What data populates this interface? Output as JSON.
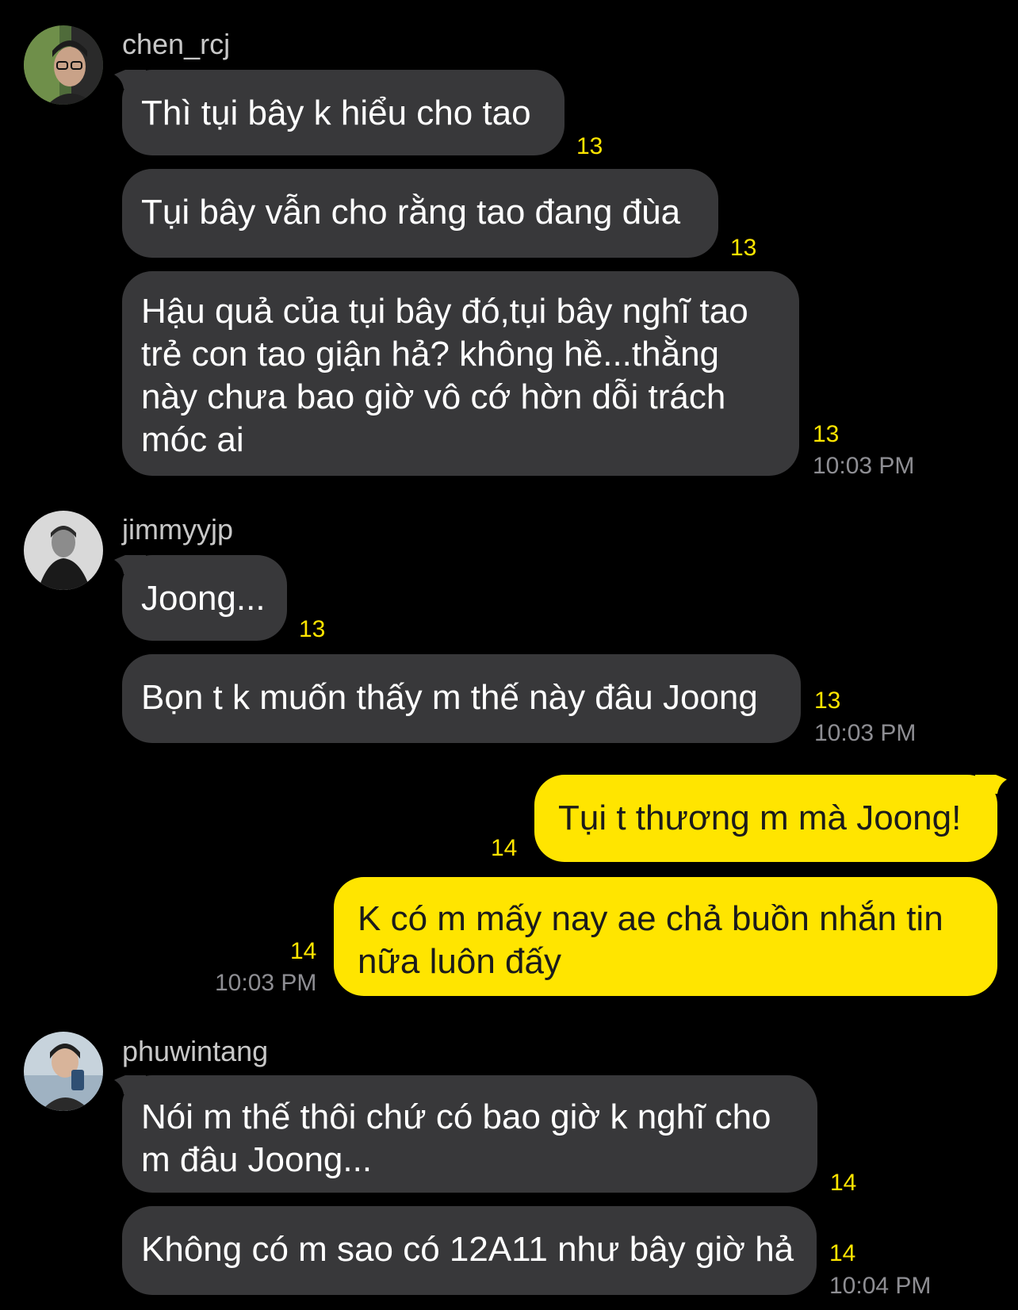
{
  "colors": {
    "background": "#000000",
    "incoming_bubble": "#38383a",
    "outgoing_bubble": "#ffe500",
    "unread_count": "#ffe500",
    "timestamp": "#8e8e93"
  },
  "groups": [
    {
      "sender": "chen_rcj",
      "avatar_icon": "profile-photo-avatar",
      "messages": [
        {
          "lines": [
            "Thì tụi bây k hiểu cho tao"
          ],
          "count": "13"
        },
        {
          "lines": [
            "Tụi bây vẫn cho rằng tao đang đùa"
          ],
          "count": "13"
        },
        {
          "lines": [
            "Hậu quả của tụi bây đó,tụi bây nghĩ tao",
            "trẻ con tao giận hả? không hề...thằng",
            "này chưa bao giờ vô cớ hờn dỗi trách",
            "móc ai"
          ],
          "count": "13",
          "time": "10:03 PM"
        }
      ]
    },
    {
      "sender": "jimmyyjp",
      "avatar_icon": "profile-photo-avatar",
      "messages": [
        {
          "lines": [
            "Joong..."
          ],
          "count": "13"
        },
        {
          "lines": [
            "Bọn t k muốn thấy m thế này đâu Joong"
          ],
          "count": "13",
          "time": "10:03 PM"
        }
      ]
    },
    {
      "sender": "me",
      "messages": [
        {
          "lines": [
            "Tụi t thương m mà Joong!"
          ],
          "count": "14"
        },
        {
          "lines": [
            "K có m mấy nay ae chả buồn nhắn tin",
            "nữa luôn đấy"
          ],
          "count": "14",
          "time": "10:03 PM"
        }
      ]
    },
    {
      "sender": "phuwintang",
      "avatar_icon": "profile-photo-avatar",
      "messages": [
        {
          "lines": [
            "Nói m thế thôi chứ có bao giờ k nghĩ cho",
            "m đâu Joong..."
          ],
          "count": "14"
        },
        {
          "lines": [
            "Không có m sao có 12A11 như bây giờ hả"
          ],
          "count": "14",
          "time": "10:04 PM"
        }
      ]
    }
  ]
}
